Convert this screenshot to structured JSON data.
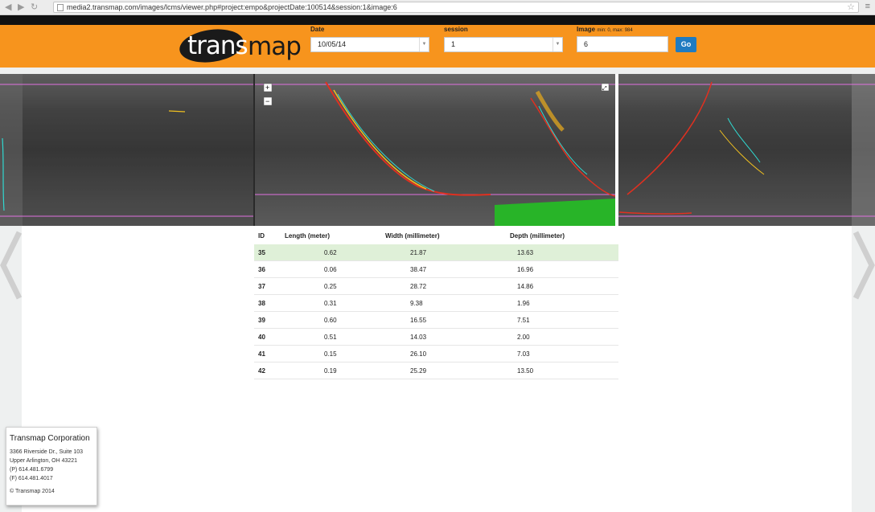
{
  "browser": {
    "url": "media2.transmap.com/images/lcms/viewer.php#project:empo&projectDate:100514&session:1&image:6"
  },
  "header": {
    "logo_part1": "trans",
    "logo_part2": "map",
    "date_label": "Date",
    "date_value": "10/05/14",
    "session_label": "session",
    "session_value": "1",
    "image_label": "Image",
    "image_hint": "min: 0, max: 984",
    "image_value": "6",
    "go_label": "Go"
  },
  "viewer": {
    "zoom_in": "+",
    "zoom_out": "−",
    "expand": "⤢"
  },
  "table": {
    "headers": [
      "ID",
      "Length (meter)",
      "Width (millimeter)",
      "Depth (millimeter)"
    ],
    "rows": [
      [
        "35",
        "0.62",
        "21.87",
        "13.63"
      ],
      [
        "36",
        "0.06",
        "38.47",
        "16.96"
      ],
      [
        "37",
        "0.25",
        "28.72",
        "14.86"
      ],
      [
        "38",
        "0.31",
        "9.38",
        "1.96"
      ],
      [
        "39",
        "0.60",
        "16.55",
        "7.51"
      ],
      [
        "40",
        "0.51",
        "14.03",
        "2.00"
      ],
      [
        "41",
        "0.15",
        "26.10",
        "7.03"
      ],
      [
        "42",
        "0.19",
        "25.29",
        "13.50"
      ]
    ],
    "selected_row": 0
  },
  "footer": {
    "company": "Transmap Corporation",
    "address1": "3366 Riverside Dr., Suite 103",
    "address2": "Upper Arlington, OH 43221",
    "phone": "(P) 614.481.6799",
    "fax": "(F) 614.481.4017",
    "copyright": "© Transmap 2014"
  },
  "colors": {
    "brand_orange": "#f7941d",
    "go_blue": "#1f7bc1",
    "selected_row": "#dff0d8"
  }
}
